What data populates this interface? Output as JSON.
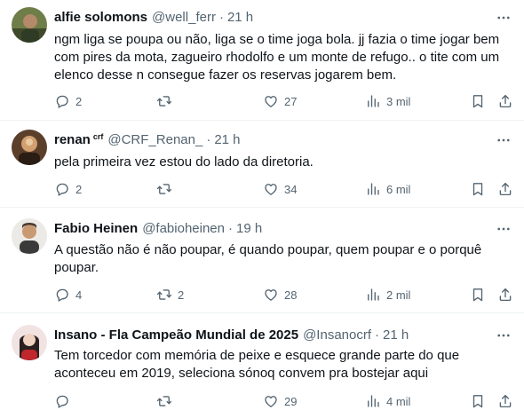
{
  "tweets": [
    {
      "name": "alfie solomons",
      "badge": "",
      "handle": "@well_ferr",
      "time": "21 h",
      "text": "ngm liga se poupa ou não, liga se o time joga bola. jj fazia o time jogar bem\ncom pires da mota, zagueiro rhodolfo e um monte de refugo.. o tite com um\nelenco desse n consegue fazer os reservas jogarem bem.",
      "replies": "2",
      "retweets": "",
      "likes": "27",
      "views": "3 mil",
      "avatar_color": "#5b6a3a"
    },
    {
      "name": "renan",
      "badge": "crf",
      "handle": "@CRF_Renan_",
      "time": "21 h",
      "text": "pela primeira vez estou do lado da diretoria.",
      "replies": "2",
      "retweets": "",
      "likes": "34",
      "views": "6 mil",
      "avatar_color": "#7a5a3c"
    },
    {
      "name": "Fabio Heinen",
      "badge": "",
      "handle": "@fabioheinen",
      "time": "19 h",
      "text": "A questão não é não poupar, é quando poupar, quem poupar e o porquê\npoupar.",
      "replies": "4",
      "retweets": "2",
      "likes": "28",
      "views": "2 mil",
      "avatar_color": "#c9a27e"
    },
    {
      "name": "Insano - Fla Campeão Mundial de 2025",
      "badge": "",
      "handle": "@Insanocrf",
      "time": "21 h",
      "text": "Tem torcedor com memória de peixe e esquece grande parte do que\naconteceu em 2019, seleciona sónoq convem pra bostejar aqui",
      "replies": "",
      "retweets": "",
      "likes": "29",
      "views": "4 mil",
      "avatar_color": "#e8c9c9"
    }
  ],
  "separator": "·",
  "icons": [
    "more-icon",
    "reply-icon",
    "retweet-icon",
    "like-icon",
    "views-icon",
    "bookmark-icon",
    "share-icon"
  ],
  "colors": {
    "text": "#0f1419",
    "secondary": "#536471",
    "divider": "#eff3f4"
  }
}
